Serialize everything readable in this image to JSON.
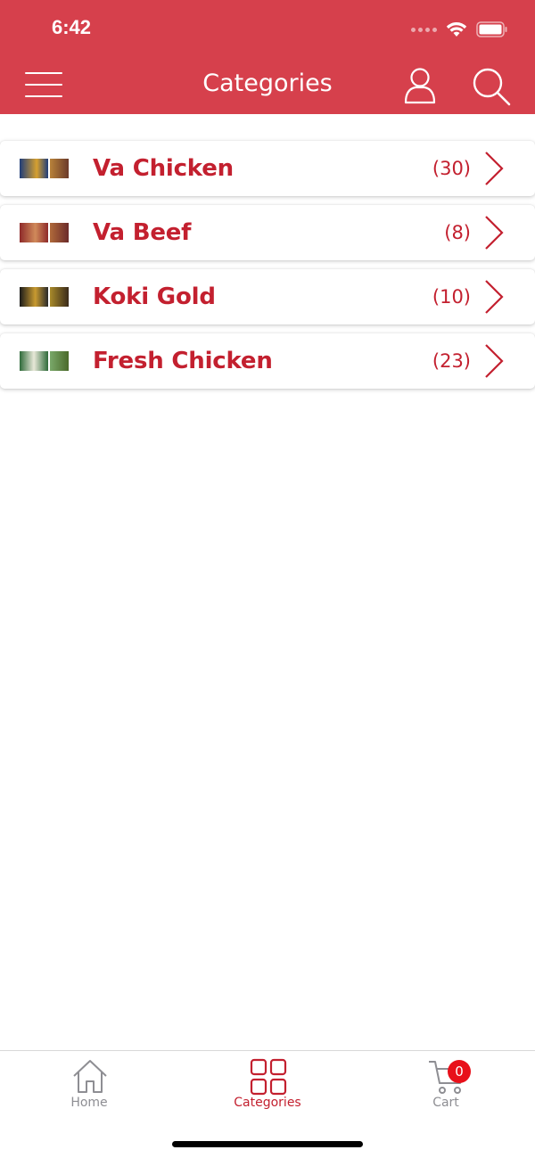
{
  "status_bar": {
    "time": "6:42",
    "icons": [
      "signal-icon",
      "wifi-icon",
      "battery-icon"
    ]
  },
  "header": {
    "title": "Categories",
    "background": "#d6404c",
    "icons": [
      "menu-icon",
      "user-icon",
      "search-icon"
    ]
  },
  "categories": [
    {
      "name": "Va Chicken",
      "count": "(30)",
      "thumb_colors": [
        "#1f3d7a",
        "#b8823a"
      ]
    },
    {
      "name": "Va Beef",
      "count": "(8)",
      "thumb_colors": [
        "#8e2a2a",
        "#b06a3a"
      ]
    },
    {
      "name": "Koki Gold",
      "count": "(10)",
      "thumb_colors": [
        "#2a2a2a",
        "#a88a2a"
      ]
    },
    {
      "name": "Fresh Chicken",
      "count": "(23)",
      "thumb_colors": [
        "#2f6a3a",
        "#7aa86a"
      ]
    }
  ],
  "tabbar": {
    "home": {
      "label": "Home",
      "icon": "home-icon"
    },
    "categories": {
      "label": "Categories",
      "icon": "grid-icon",
      "active": true
    },
    "cart": {
      "label": "Cart",
      "icon": "cart-icon",
      "badge": "0"
    }
  },
  "colors": {
    "accent": "#c3202f",
    "inactive": "#8e8e93",
    "badge": "#e8101a"
  }
}
